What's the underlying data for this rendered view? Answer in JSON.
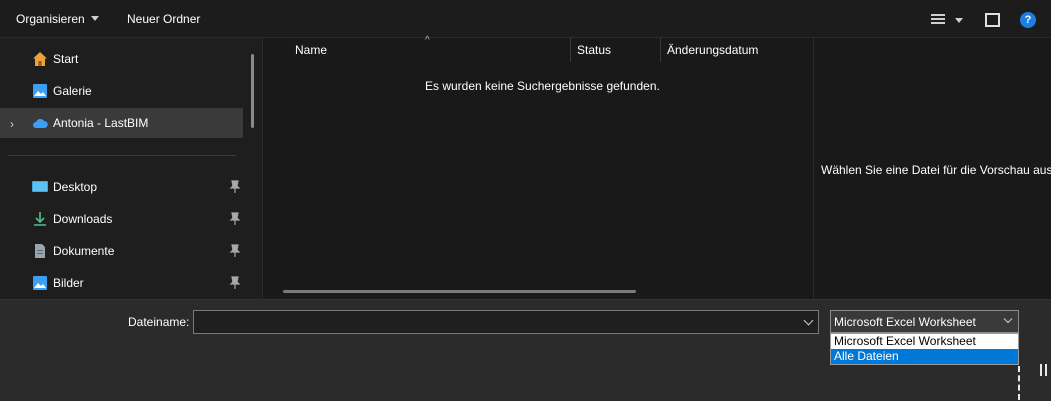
{
  "toolbar": {
    "organize_label": "Organisieren",
    "new_folder_label": "Neuer Ordner",
    "help_glyph": "?"
  },
  "sidebar": {
    "items": [
      {
        "label": "Start",
        "icon": "home-icon"
      },
      {
        "label": "Galerie",
        "icon": "gallery-icon"
      },
      {
        "label": "Antonia - LastBIM",
        "icon": "onedrive-cloud-icon",
        "selected": true
      },
      {
        "label": "Desktop",
        "icon": "desktop-icon",
        "pinned": true
      },
      {
        "label": "Downloads",
        "icon": "download-icon",
        "pinned": true
      },
      {
        "label": "Dokumente",
        "icon": "document-icon",
        "pinned": true
      },
      {
        "label": "Bilder",
        "icon": "pictures-icon",
        "pinned": true
      }
    ]
  },
  "file_list": {
    "columns": [
      "Name",
      "Status",
      "Änderungsdatum"
    ],
    "empty_message": "Es wurden keine Suchergebnisse gefunden."
  },
  "preview": {
    "message": "Wählen Sie eine Datei für die Vorschau aus."
  },
  "footer": {
    "filename_label": "Dateiname:",
    "filename_value": "",
    "filetype_selected": "Microsoft Excel Worksheet",
    "filetype_options": [
      "Microsoft Excel Worksheet",
      "Alle Dateien"
    ],
    "highlighted_option": "Alle Dateien"
  },
  "colors": {
    "accent": "#0078d7",
    "help_blue": "#1a7fe0",
    "onedrive_blue": "#3a9ff5"
  }
}
